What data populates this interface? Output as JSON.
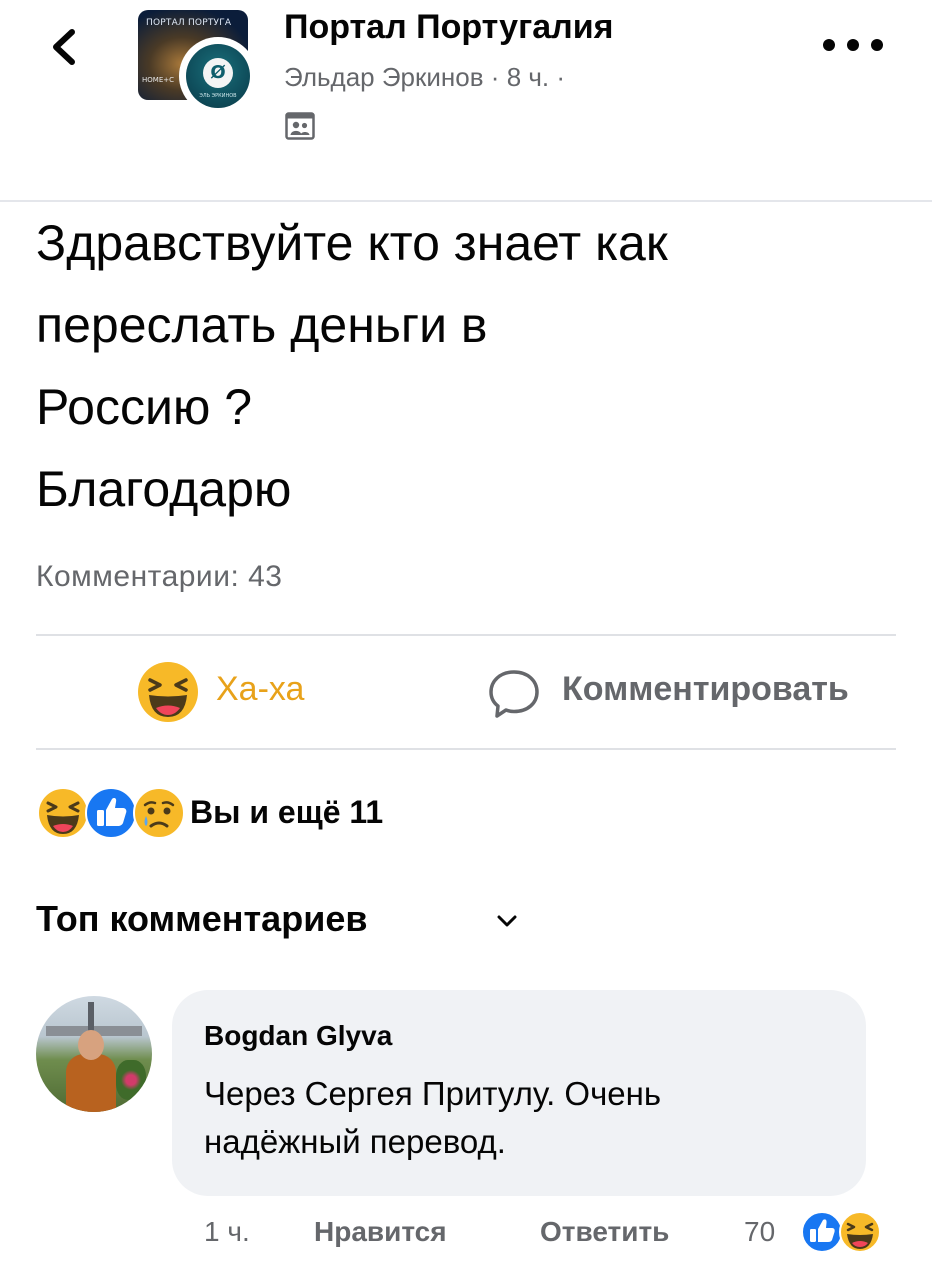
{
  "header": {
    "group_name": "Портал Португалия",
    "author": "Эльдар Эркинов",
    "time": "8 ч.",
    "separator": "·",
    "group_avatar_text": "ПОРТАЛ ПОРТУГА",
    "group_avatar_subtext": "HOME+C",
    "author_avatar_text": "ЭЛЬ ЭРКИНОВ"
  },
  "post": {
    "lines": [
      "Здравствуйте кто знает как",
      "переслать деньги в",
      "Россию ?",
      "Благодарю"
    ],
    "comments_count": "Комментарии: 43"
  },
  "actions": {
    "reaction_label": "Ха-ха",
    "comment_label": "Комментировать"
  },
  "reactions_summary": {
    "label": "Вы и ещё 11"
  },
  "top_comments": {
    "label": "Топ комментариев"
  },
  "comment": {
    "author": "Bogdan Glyva",
    "lines": [
      "Через Сергея Притулу. Очень",
      "надёжный перевод."
    ],
    "time": "1 ч.",
    "like_label": "Нравится",
    "reply_label": "Ответить",
    "reaction_count": "70"
  },
  "colors": {
    "haha_yellow": "#f7b928",
    "like_blue": "#1877f2",
    "secondary_text": "#65676b",
    "bubble_bg": "#f0f2f5"
  },
  "icons": [
    "back-arrow-icon",
    "more-icon",
    "people-icon",
    "haha-icon",
    "comment-icon",
    "like-icon",
    "sad-icon",
    "chevron-down-icon"
  ]
}
